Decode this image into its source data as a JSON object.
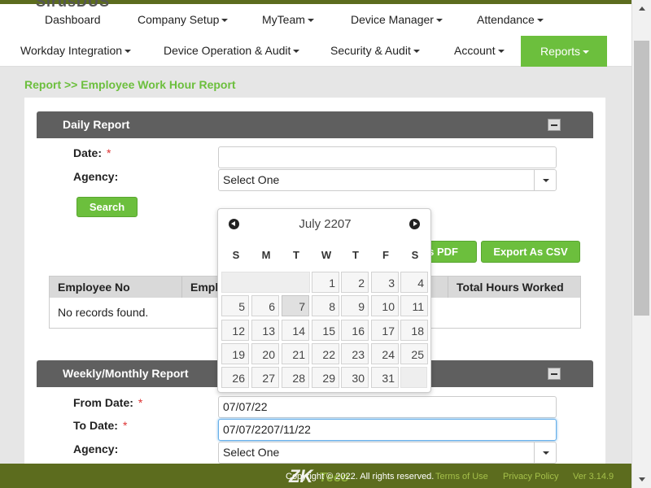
{
  "nav": {
    "logo_partial": "SirusDUS",
    "row1": [
      {
        "label": "Dashboard",
        "caret": false
      },
      {
        "label": "Company Setup",
        "caret": true
      },
      {
        "label": "MyTeam",
        "caret": true
      },
      {
        "label": "Device Manager",
        "caret": true
      },
      {
        "label": "Attendance",
        "caret": true
      }
    ],
    "row2": [
      {
        "label": "Workday Integration",
        "caret": true
      },
      {
        "label": "Device Operation & Audit",
        "caret": true
      },
      {
        "label": "Security & Audit",
        "caret": true
      },
      {
        "label": "Account",
        "caret": true
      },
      {
        "label": "Reports",
        "caret": true,
        "active": true
      }
    ]
  },
  "breadcrumb": "Report >> Employee Work Hour Report",
  "daily": {
    "title": "Daily Report",
    "date_label": "Date:",
    "date_value": "",
    "agency_label": "Agency:",
    "agency_value": "Select One",
    "search_button": "Search",
    "export_pdf_button": "Export As PDF",
    "export_pdf_visible": "s PDF",
    "export_csv_button": "Export As CSV",
    "table": {
      "columns": [
        "Employee No",
        "Employee Name",
        "",
        "Total Hours Worked"
      ],
      "columns_visible": [
        "Employee No",
        "Emplo",
        "",
        "Total Hours Worked"
      ],
      "empty_message": "No records found."
    }
  },
  "weekly": {
    "title": "Weekly/Monthly Report",
    "from_label": "From Date:",
    "from_value": "07/07/22",
    "to_label": "To Date:",
    "to_value": "07/07/2207/11/22",
    "agency_label": "Agency:",
    "agency_value": "Select One"
  },
  "required_mark": "*",
  "calendar": {
    "month_year": "July 2207",
    "days_of_week": [
      "S",
      "M",
      "T",
      "W",
      "T",
      "F",
      "S"
    ],
    "leading_blanks": 3,
    "days_in_month": 31,
    "today": 7
  },
  "footer": {
    "copyright": "Copyright © 2022. All rights reserved.",
    "terms": "Terms of Use",
    "privacy": "Privacy Policy",
    "version": "Ver 3.14.9",
    "logo_zk": "ZK",
    "logo_teco": "Teco"
  },
  "colors": {
    "accent": "#6cbf3d",
    "header_bar": "#5f5f5f",
    "footer": "#5c6c1e"
  }
}
